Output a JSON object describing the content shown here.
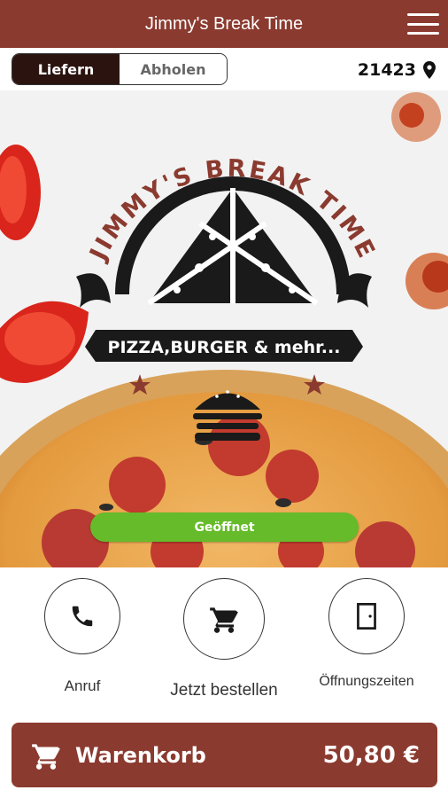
{
  "app_bar": {
    "title": "Jimmy's Break Time",
    "menu_icon": "hamburger-menu-icon"
  },
  "mode_toggle": {
    "options": [
      "Liefern",
      "Abholen"
    ],
    "selected": "Liefern"
  },
  "location": {
    "zip": "21423",
    "icon": "location-pin-icon"
  },
  "hero": {
    "logo_arc_text": "JIMMY'S BREAK TIME",
    "logo_banner_text": "PIZZA,BURGER & mehr...",
    "status": "Geöffnet"
  },
  "actions": [
    {
      "label": "Anruf",
      "icon": "phone-icon"
    },
    {
      "label": "Jetzt bestellen",
      "icon": "cart-icon"
    },
    {
      "label": "Öffnungszeiten",
      "icon": "door-icon"
    }
  ],
  "cart": {
    "label": "Warenkorb",
    "total": "50,80 €",
    "icon": "cart-icon"
  },
  "colors": {
    "brand": "#8b3a2f",
    "status_open": "#66bb2a",
    "toggle_active": "#2b1410"
  }
}
